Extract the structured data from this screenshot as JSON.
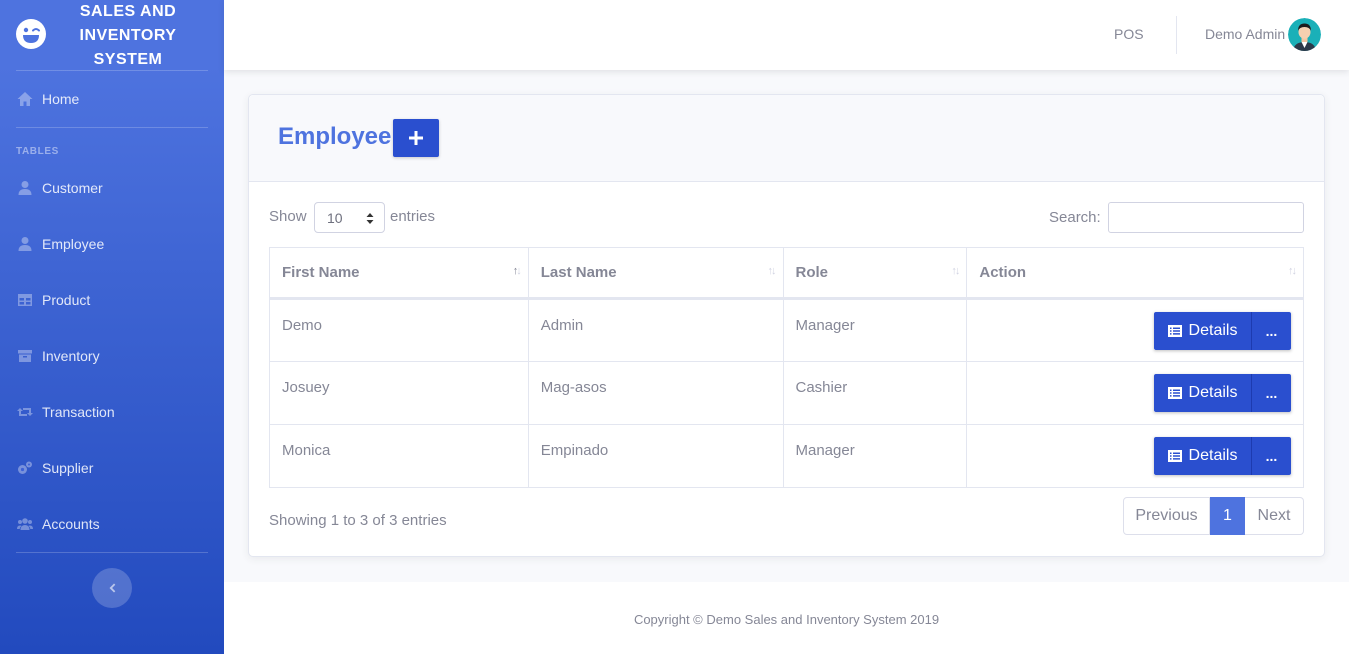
{
  "brand": {
    "title": "SALES AND INVENTORY SYSTEM"
  },
  "sidebar": {
    "home": "Home",
    "heading": "TABLES",
    "items": [
      {
        "label": "Customer",
        "icon": "user-icon"
      },
      {
        "label": "Employee",
        "icon": "user-icon"
      },
      {
        "label": "Product",
        "icon": "table-icon"
      },
      {
        "label": "Inventory",
        "icon": "archive-icon"
      },
      {
        "label": "Transaction",
        "icon": "retweet-icon"
      },
      {
        "label": "Supplier",
        "icon": "cogs-icon"
      },
      {
        "label": "Accounts",
        "icon": "users-icon"
      }
    ]
  },
  "topbar": {
    "pos": "POS",
    "user": "Demo Admin"
  },
  "card": {
    "title": "Employee",
    "show_label": "Show",
    "entries_value": "10",
    "entries_label": "entries",
    "search_label": "Search:",
    "search_value": ""
  },
  "table": {
    "headers": [
      "First Name",
      "Last Name",
      "Role",
      "Action"
    ],
    "rows": [
      {
        "first": "Demo",
        "last": "Admin",
        "role": "Manager"
      },
      {
        "first": "Josuey",
        "last": "Mag-asos",
        "role": "Cashier"
      },
      {
        "first": "Monica",
        "last": "Empinado",
        "role": "Manager"
      }
    ],
    "details_label": "Details",
    "more_label": "..."
  },
  "pagination": {
    "info": "Showing 1 to 3 of 3 entries",
    "previous": "Previous",
    "current": "1",
    "next": "Next"
  },
  "footer": {
    "text": "Copyright © Demo Sales and Inventory System 2019"
  },
  "colors": {
    "primary": "#4e73df",
    "primary_dark": "#224abe",
    "button": "#2a4fcf"
  }
}
